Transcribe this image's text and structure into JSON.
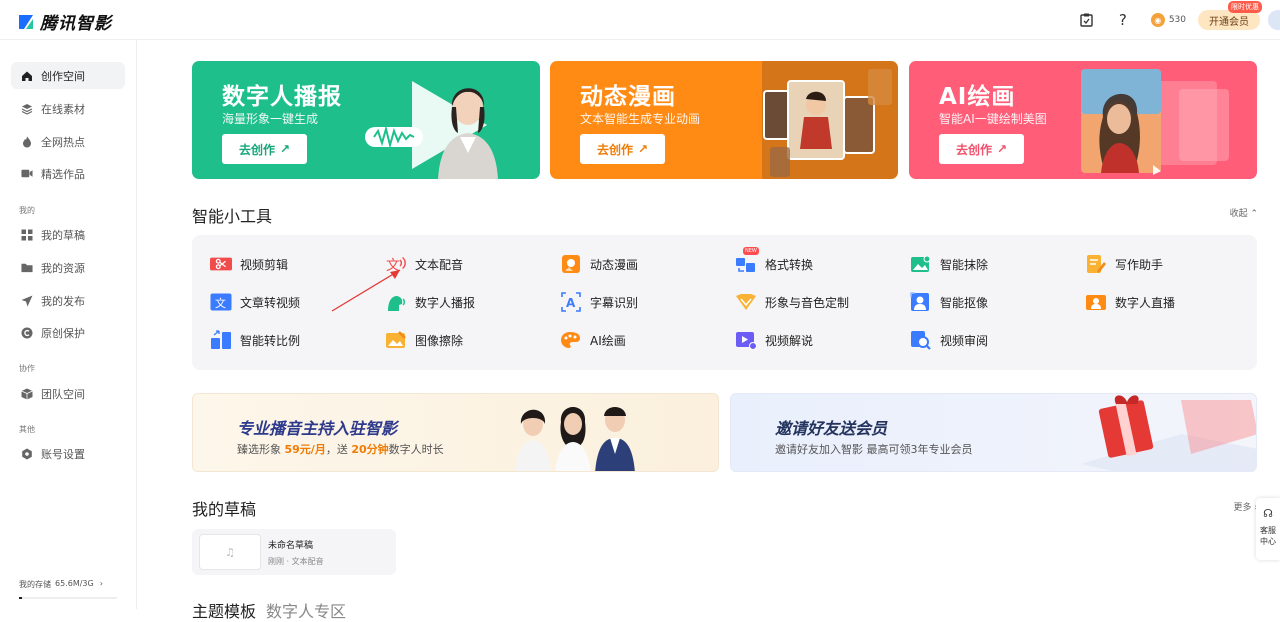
{
  "app": {
    "logo_text": "腾讯智影"
  },
  "topbar": {
    "coins": "530",
    "vip_label": "开通会员",
    "vip_badge": "限时优惠"
  },
  "sidebar": {
    "items": [
      {
        "label": "创作空间",
        "icon": "home-icon"
      },
      {
        "label": "在线素材",
        "icon": "layers-icon"
      },
      {
        "label": "全网热点",
        "icon": "fire-icon"
      },
      {
        "label": "精选作品",
        "icon": "video-icon"
      }
    ],
    "section_mine": "我的",
    "mine_items": [
      {
        "label": "我的草稿",
        "icon": "grid-icon"
      },
      {
        "label": "我的资源",
        "icon": "folder-icon"
      },
      {
        "label": "我的发布",
        "icon": "send-icon"
      },
      {
        "label": "原创保护",
        "icon": "copyright-icon"
      }
    ],
    "section_collab": "协作",
    "collab_items": [
      {
        "label": "团队空间",
        "icon": "cube-icon"
      }
    ],
    "section_other": "其他",
    "other_items": [
      {
        "label": "账号设置",
        "icon": "settings-icon"
      }
    ],
    "storage_label": "我的存储",
    "storage_value": "65.6M/3G",
    "storage_fraction": 0.02
  },
  "heroes": [
    {
      "title": "数字人播报",
      "subtitle": "海量形象一键生成",
      "button": "去创作",
      "color": "#1fbf8c",
      "btn_text_color": "#16a679"
    },
    {
      "title": "动态漫画",
      "subtitle": "文本智能生成专业动画",
      "button": "去创作",
      "color": "#ff8a14",
      "btn_text_color": "#f07c06"
    },
    {
      "title": "AI绘画",
      "subtitle": "智能AI一键绘制美图",
      "button": "去创作",
      "color": "#ff5d78",
      "btn_text_color": "#f0506b"
    }
  ],
  "tools_section": {
    "title": "智能小工具",
    "collapse_label": "收起",
    "tools": [
      {
        "label": "视频剪辑",
        "icon": "video-edit-icon"
      },
      {
        "label": "文本配音",
        "icon": "text-voice-icon"
      },
      {
        "label": "动态漫画",
        "icon": "comic-icon"
      },
      {
        "label": "格式转换",
        "icon": "format-convert-icon"
      },
      {
        "label": "智能抹除",
        "icon": "smart-erase-icon"
      },
      {
        "label": "写作助手",
        "icon": "writing-icon"
      },
      {
        "label": "文章转视频",
        "icon": "article-video-icon"
      },
      {
        "label": "数字人播报",
        "icon": "digital-human-icon"
      },
      {
        "label": "字幕识别",
        "icon": "subtitle-icon"
      },
      {
        "label": "形象与音色定制",
        "icon": "customize-icon"
      },
      {
        "label": "智能抠像",
        "icon": "matting-icon"
      },
      {
        "label": "数字人直播",
        "icon": "live-icon"
      },
      {
        "label": "智能转比例",
        "icon": "ratio-icon"
      },
      {
        "label": "图像擦除",
        "icon": "image-erase-icon"
      },
      {
        "label": "AI绘画",
        "icon": "palette-icon"
      },
      {
        "label": "视频解说",
        "icon": "video-narration-icon"
      },
      {
        "label": "视频审阅",
        "icon": "video-review-icon"
      }
    ],
    "new_badge": "NEW"
  },
  "banners": [
    {
      "title": "专业播音主持入驻智影",
      "sub_prefix": "臻选形象 ",
      "sub_price": "59元/月",
      "sub_mid": "，送 ",
      "sub_minutes": "20分钟",
      "sub_suffix": "数字人时长"
    },
    {
      "title": "邀请好友送会员",
      "subtitle": "邀请好友加入智影 最高可领3年专业会员"
    }
  ],
  "drafts": {
    "title": "我的草稿",
    "more_label": "更多",
    "items": [
      {
        "name": "未命名草稿",
        "meta": "刚刚 · 文本配音"
      }
    ]
  },
  "service": {
    "label_1": "客服",
    "label_2": "中心"
  },
  "bottom": {
    "title": "主题模板",
    "tab": "数字人专区"
  }
}
